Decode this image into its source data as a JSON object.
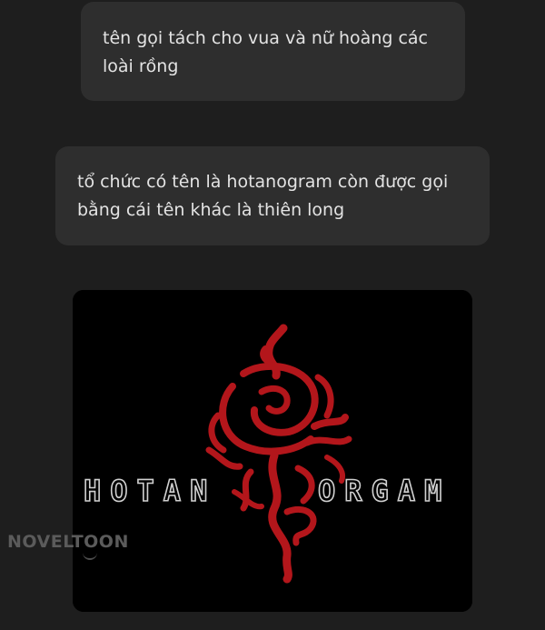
{
  "messages": [
    {
      "text": "tên gọi tách cho vua và nữ hoàng các loài rồng"
    },
    {
      "text": "tổ chức có tên là hotanogram còn được gọi bằng cái tên khác là thiên long"
    }
  ],
  "image": {
    "logo_text_left": "HOTAN",
    "logo_text_right": "ORGAM",
    "colors": {
      "background": "#000000",
      "rose": "#b3161b",
      "letters_outline": "#d0d0d0"
    }
  },
  "watermark": {
    "text": "NOVELTOON"
  },
  "colors": {
    "page_background": "#1e1e1e",
    "bubble_background": "#2e2e2e",
    "bubble_text": "#e3e3e3"
  }
}
